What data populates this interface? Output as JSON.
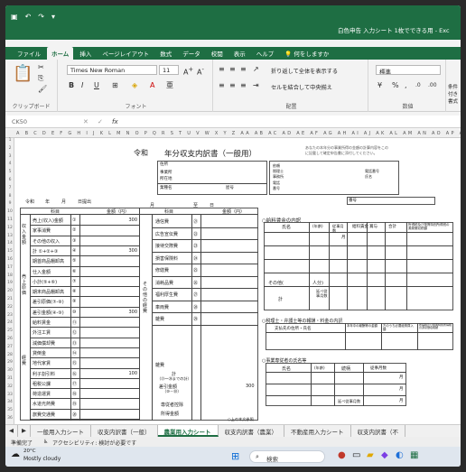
{
  "window": {
    "title": "白色申告 入力シート 1枚でできる用 - Exc",
    "undo_icon": "undo-icon",
    "redo_icon": "redo-icon"
  },
  "ribbon_tabs": [
    "ファイル",
    "ホーム",
    "挿入",
    "ページレイアウト",
    "数式",
    "データ",
    "校閲",
    "表示",
    "ヘルプ",
    "何をしますか"
  ],
  "ribbon": {
    "font_name": "Times New Roman",
    "font_size": "11",
    "wrap_text": "折り返して全体を表示する",
    "merge_center": "セルを結合して中央揃え",
    "number_format": "標準",
    "groups": [
      "クリップボード",
      "フォント",
      "配置",
      "数値"
    ],
    "conditional_format": "条件付き書式"
  },
  "formula_bar": {
    "name_box": "CK50",
    "fx": "fx",
    "content": ""
  },
  "sheet": {
    "form_era": "令和",
    "form_title": "年分収支内訳書（一般用）",
    "notice_1": "あなたの本年分の事業所得の金額の計算内容をこの",
    "notice_2": "に記載して確定申告書に添付してください。",
    "header_labels": [
      "住所",
      "事業所",
      "所在地",
      "業種名",
      "屋号"
    ],
    "right_labels": [
      "依頼",
      "税理士",
      "事務所",
      "電話",
      "番号",
      "電話番号",
      "氏名"
    ],
    "date_labels": [
      "令和",
      "年",
      "月",
      "日提出"
    ],
    "number_label": "番号",
    "col_kamoku": "科目",
    "col_kingaku": "金額（円）",
    "col_tsuki": "月",
    "col_hi": "日",
    "col_shi": "至",
    "left_items": [
      {
        "label": "売上(収入)金額",
        "num": "①",
        "amount": "300"
      },
      {
        "label": "家事消費",
        "num": "②",
        "amount": ""
      },
      {
        "label": "その他の収入",
        "num": "③",
        "amount": ""
      },
      {
        "label": "計 ①+②+③",
        "num": "④",
        "amount": "300"
      },
      {
        "label": "期首商品棚卸高",
        "num": "⑤",
        "amount": ""
      },
      {
        "label": "仕入金額",
        "num": "⑥",
        "amount": ""
      },
      {
        "label": "小計(⑤+⑥)",
        "num": "⑦",
        "amount": ""
      },
      {
        "label": "期末商品棚卸高",
        "num": "⑧",
        "amount": ""
      },
      {
        "label": "差引原価(⑦-⑧)",
        "num": "⑨",
        "amount": ""
      },
      {
        "label": "差引金額(④-⑨)",
        "num": "⑩",
        "amount": "300"
      },
      {
        "label": "給料賃金",
        "num": "⑪",
        "amount": ""
      },
      {
        "label": "外注工賃",
        "num": "⑫",
        "amount": ""
      },
      {
        "label": "減価償却費",
        "num": "⑬",
        "amount": ""
      },
      {
        "label": "貸倒金",
        "num": "⑭",
        "amount": ""
      },
      {
        "label": "地代家賃",
        "num": "⑮",
        "amount": ""
      },
      {
        "label": "利子割引料",
        "num": "⑯",
        "amount": "100"
      },
      {
        "label": "租税公課",
        "num": "⑰",
        "amount": ""
      },
      {
        "label": "荷造運賃",
        "num": "⑱",
        "amount": ""
      },
      {
        "label": "水道光熱費",
        "num": "⑲",
        "amount": ""
      },
      {
        "label": "旅費交通費",
        "num": "⑳",
        "amount": ""
      }
    ],
    "left_group_labels": [
      "収入金額",
      "売上原価",
      "経費"
    ],
    "middle_items": [
      {
        "label": "通信費",
        "num": "㉑"
      },
      {
        "label": "広告宣伝費",
        "num": "㉒"
      },
      {
        "label": "接待交際費",
        "num": "㉓"
      },
      {
        "label": "損害保険料",
        "num": "㉔"
      },
      {
        "label": "修繕費",
        "num": "㉕"
      },
      {
        "label": "消耗品費",
        "num": "㉖"
      },
      {
        "label": "福利厚生費",
        "num": "㉗"
      },
      {
        "label": "車両費",
        "num": "㉘"
      },
      {
        "label": "雑費",
        "num": "㉙"
      }
    ],
    "middle_group_label": "その他の経費",
    "middle_bottom_labels": [
      "雑費",
      "計",
      "（㉑〜㉙までの計）",
      "差引金額",
      "（⑩－㉚）",
      "専従者控除",
      "所得金額"
    ],
    "middle_bottom_amounts": [
      "",
      "",
      "300"
    ],
    "sec_salary_title": "○給料賃金の内訳",
    "salary_headers": [
      "氏名",
      "(年齢)",
      "従事月数",
      "給料賃金",
      "賞与",
      "合計",
      "所得税及び復興特別所得税の源泉徴収税額"
    ],
    "salary_month_unit": "月",
    "salary_other": "その他(",
    "salary_other_unit": "人分)",
    "salary_total": "計",
    "salary_total_sub": "延べ従事月数",
    "sec_tax_title": "○税理士・弁護士等の報酬・料金の内訳",
    "tax_headers": [
      "支払先の住所・氏名",
      "本年中の報酬等の金額",
      "左のうち必要経費算入額",
      "所得税及び復興特別所得税の源泉徴収税額"
    ],
    "sec_family_title": "○事業専従者の氏名等",
    "family_headers": [
      "氏名",
      "(年齢)",
      "続柄",
      "従事月数"
    ],
    "family_month_unit": "月",
    "family_total": "延べ従事月数",
    "bottom_note": "○上の本文参照"
  },
  "sheet_tabs": [
    "一般用入力シート",
    "収支内訳書（一般）",
    "農業用入力シート",
    "収支内訳書（農業）",
    "不動産用入力シート",
    "収支内訳書（不"
  ],
  "status": {
    "ready": "準備完了",
    "accessibility": "アクセシビリティ: 検討が必要です"
  },
  "taskbar": {
    "weather_temp": "20°C",
    "weather_text": "Mostly cloudy",
    "search_placeholder": "検索"
  },
  "colors": {
    "excel_green": "#1e6e43",
    "ribbon_bg": "#f3f3f3"
  }
}
